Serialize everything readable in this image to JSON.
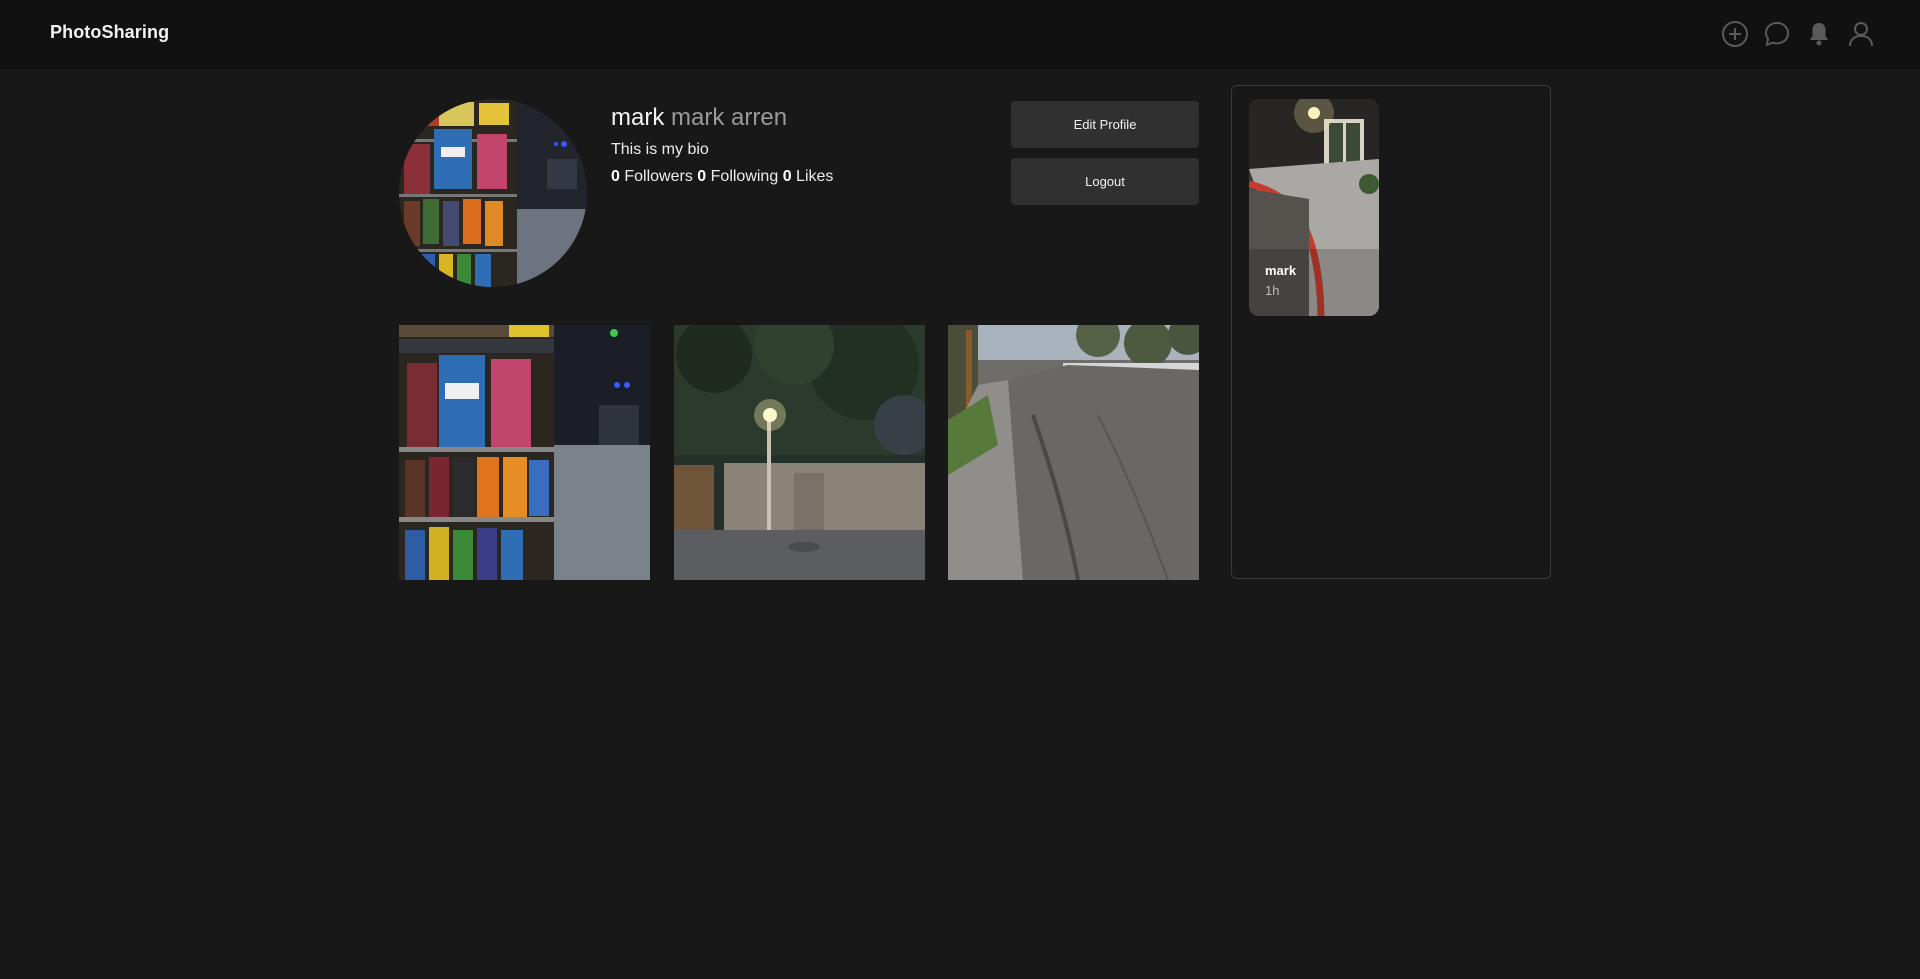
{
  "app": {
    "brand": "PhotoSharing"
  },
  "nav_icons": [
    "add-circle-icon",
    "chat-bubble-icon",
    "bell-icon",
    "user-icon"
  ],
  "profile": {
    "username": "mark",
    "full_name": "mark arren",
    "bio": "This is my bio",
    "followers_count": "0",
    "followers_label": "Followers",
    "following_count": "0",
    "following_label": "Following",
    "likes_count": "0",
    "likes_label": "Likes"
  },
  "actions": {
    "edit_profile": "Edit Profile",
    "logout": "Logout"
  },
  "stories": [
    {
      "user": "mark",
      "time": "1h"
    }
  ],
  "colors": {
    "background": "#181818",
    "topbar": "#111111",
    "button": "#303030",
    "muted_text": "#9a9a9a"
  }
}
